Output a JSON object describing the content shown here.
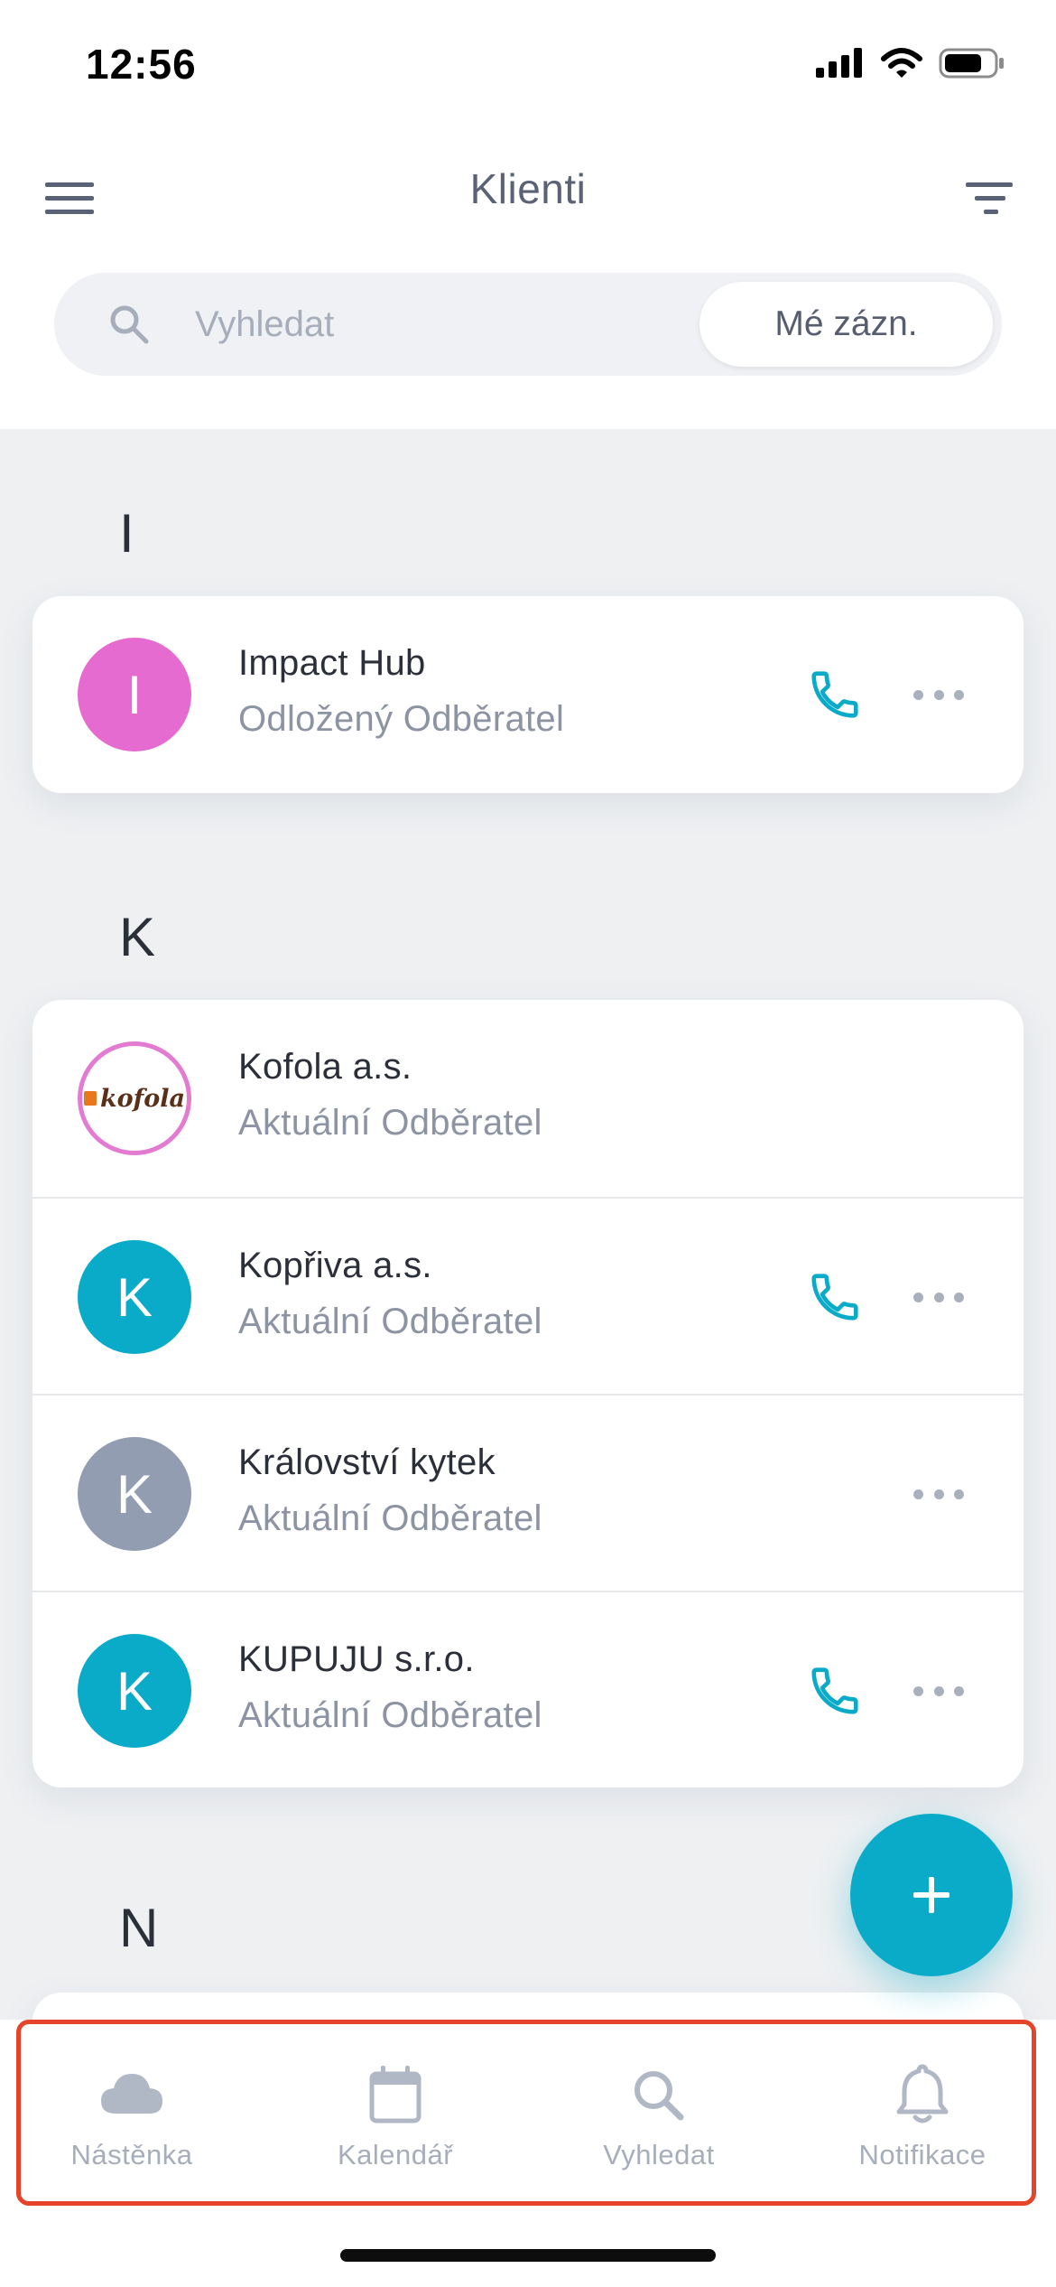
{
  "status_bar": {
    "time": "12:56"
  },
  "header": {
    "title": "Klienti",
    "search_placeholder": "Vyhledat",
    "my_records_label": "Mé zázn."
  },
  "sections": [
    {
      "letter": "I",
      "clients": [
        {
          "initial": "I",
          "name": "Impact Hub",
          "status": "Odložený Odběratel",
          "avatar_color": "#e66bd1",
          "has_phone": true,
          "has_more": true
        }
      ]
    },
    {
      "letter": "K",
      "clients": [
        {
          "initial": "",
          "logo_text": "kofola",
          "name": "Kofola a.s.",
          "status": "Aktuální Odběratel",
          "avatar_color": "#e27bd1",
          "has_phone": false,
          "has_more": false
        },
        {
          "initial": "K",
          "name": "Kopřiva a.s.",
          "status": "Aktuální Odběratel",
          "avatar_color": "#0aaac9",
          "has_phone": true,
          "has_more": true
        },
        {
          "initial": "K",
          "name": "Království kytek",
          "status": "Aktuální Odběratel",
          "avatar_color": "#939db2",
          "has_phone": false,
          "has_more": true
        },
        {
          "initial": "K",
          "name": "KUPUJU s.r.o.",
          "status": "Aktuální Odběratel",
          "avatar_color": "#0aaac9",
          "has_phone": true,
          "has_more": true
        }
      ]
    },
    {
      "letter": "N",
      "clients": []
    }
  ],
  "tabs": [
    {
      "label": "Nástěnka",
      "icon": "cloud-icon"
    },
    {
      "label": "Kalendář",
      "icon": "calendar-icon"
    },
    {
      "label": "Vyhledat",
      "icon": "search-icon"
    },
    {
      "label": "Notifikace",
      "icon": "bell-icon"
    }
  ],
  "colors": {
    "accent": "#0aaac9",
    "highlight_border": "#e5442a",
    "tab_inactive": "#a7aebb"
  }
}
